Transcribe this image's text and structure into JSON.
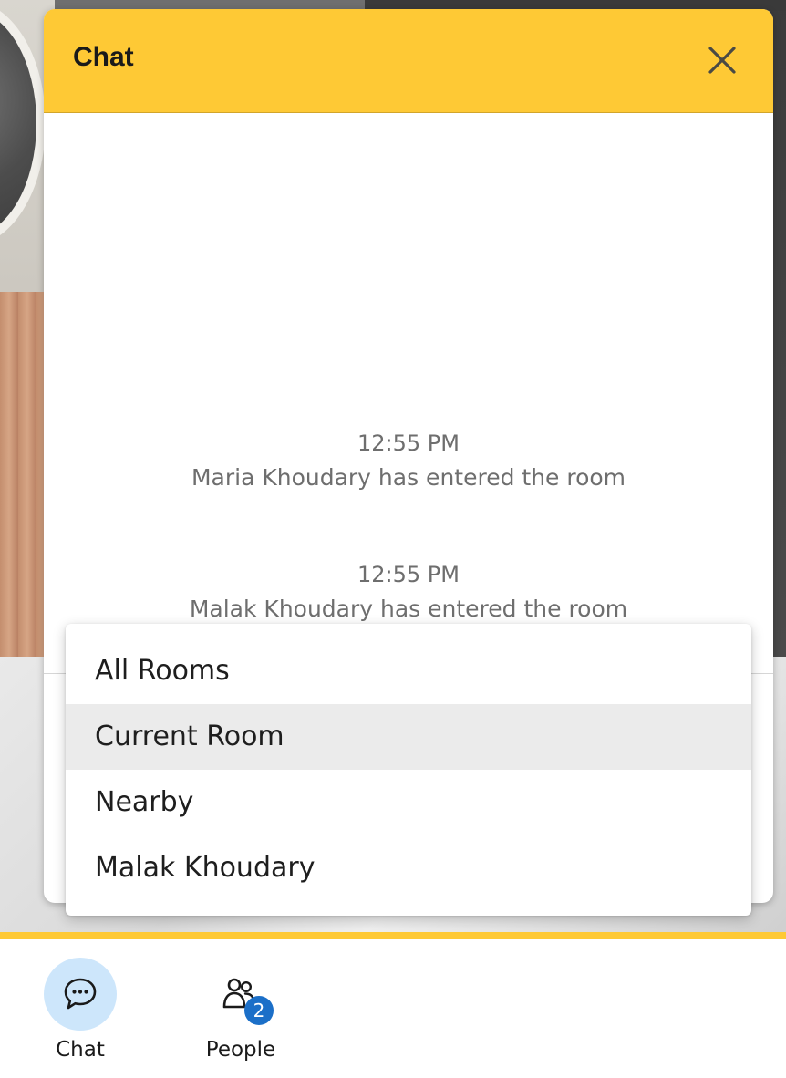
{
  "header": {
    "title": "Chat",
    "close_icon": "close-icon"
  },
  "messages": [
    {
      "time": "12:55 PM",
      "text": "Maria Khoudary has entered the room"
    },
    {
      "time": "12:55 PM",
      "text": "Malak Khoudary has entered the room"
    }
  ],
  "dropdown": {
    "options": [
      "All Rooms",
      "Current Room",
      "Nearby",
      "Malak Khoudary"
    ],
    "selected": "Current Room"
  },
  "bottom_nav": {
    "chat": {
      "label": "Chat",
      "icon": "chat-bubble-icon",
      "active": true
    },
    "people": {
      "label": "People",
      "icon": "people-icon",
      "badge": "2"
    }
  },
  "colors": {
    "header_bg": "#fec935",
    "active_nav_bg": "#cde6fb",
    "badge_bg": "#1b6fc8",
    "selected_option_bg": "#ebebeb"
  }
}
